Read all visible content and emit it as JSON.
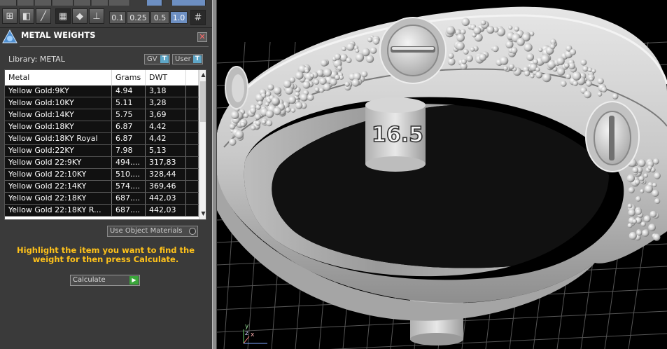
{
  "toolbar": {
    "zoom_values": [
      "0.1",
      "0.25",
      "0.5",
      "1.0"
    ],
    "active_zoom": "1.0"
  },
  "panel": {
    "title": "METAL WEIGHTS",
    "close_label": "✕",
    "library_label": "Library: METAL",
    "lib_buttons": [
      {
        "label": "GV",
        "tag": "T"
      },
      {
        "label": "User",
        "tag": "T"
      }
    ],
    "columns": [
      "Metal",
      "Grams",
      "DWT"
    ],
    "rows": [
      {
        "metal": "Yellow Gold:9KY",
        "grams": "4.94",
        "dwt": "3,18"
      },
      {
        "metal": "Yellow Gold:10KY",
        "grams": "5.11",
        "dwt": "3,28"
      },
      {
        "metal": "Yellow Gold:14KY",
        "grams": "5.75",
        "dwt": "3,69"
      },
      {
        "metal": "Yellow Gold:18KY",
        "grams": "6.87",
        "dwt": "4,42"
      },
      {
        "metal": "Yellow Gold:18KY Royal",
        "grams": "6.87",
        "dwt": "4,42"
      },
      {
        "metal": "Yellow Gold:22KY",
        "grams": "7.98",
        "dwt": "5,13"
      },
      {
        "metal": "Yellow Gold 22:9KY",
        "grams": "494....",
        "dwt": "317,83"
      },
      {
        "metal": "Yellow Gold 22:10KY",
        "grams": "510....",
        "dwt": "328,44"
      },
      {
        "metal": "Yellow Gold 22:14KY",
        "grams": "574....",
        "dwt": "369,46"
      },
      {
        "metal": "Yellow Gold 22:18KY",
        "grams": "687....",
        "dwt": "442,03"
      },
      {
        "metal": "Yellow Gold 22:18KY R...",
        "grams": "687....",
        "dwt": "442,03"
      }
    ],
    "use_object_materials": "Use Object Materials",
    "hint": "Highlight the item you want to find the weight for then press Calculate.",
    "calculate_label": "Calculate",
    "calculate_arrow": "▶"
  },
  "viewport": {
    "ring_size_label": "16.5",
    "axis_x": "x",
    "axis_y": "y",
    "axis_z": "z"
  }
}
